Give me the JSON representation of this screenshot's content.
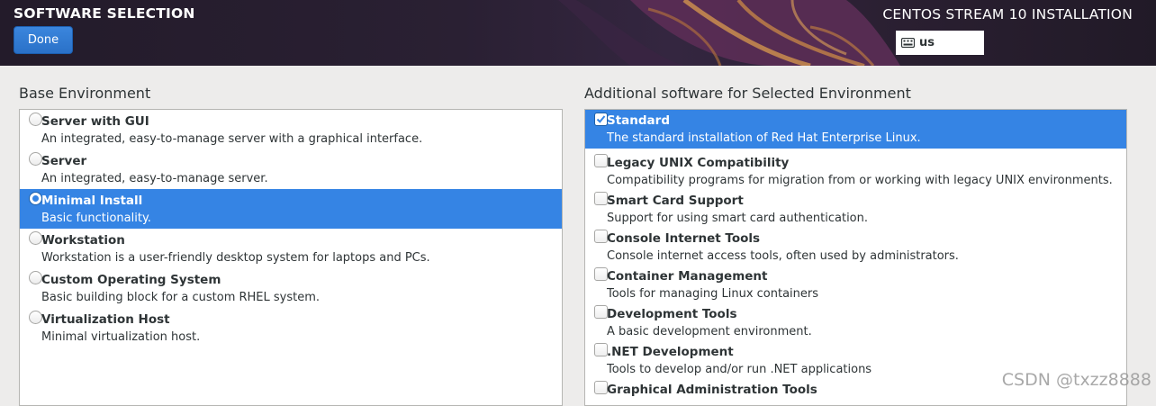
{
  "header": {
    "page_title": "SOFTWARE SELECTION",
    "done_label": "Done",
    "product_title": "CENTOS STREAM 10 INSTALLATION",
    "keyboard_layout": "us",
    "keyboard_icon": "keyboard-icon",
    "accent_color": "#3584e4"
  },
  "base_environment": {
    "title": "Base Environment",
    "selected_index": 2,
    "items": [
      {
        "name": "Server with GUI",
        "desc": "An integrated, easy-to-manage server with a graphical interface.",
        "selected": false
      },
      {
        "name": "Server",
        "desc": "An integrated, easy-to-manage server.",
        "selected": false
      },
      {
        "name": "Minimal Install",
        "desc": "Basic functionality.",
        "selected": true
      },
      {
        "name": "Workstation",
        "desc": "Workstation is a user-friendly desktop system for laptops and PCs.",
        "selected": false
      },
      {
        "name": "Custom Operating System",
        "desc": "Basic building block for a custom RHEL system.",
        "selected": false
      },
      {
        "name": "Virtualization Host",
        "desc": "Minimal virtualization host.",
        "selected": false
      }
    ]
  },
  "additional_software": {
    "title": "Additional software for Selected Environment",
    "items": [
      {
        "name": "Standard",
        "desc": "The standard installation of Red Hat Enterprise Linux.",
        "checked": true,
        "highlighted": true
      },
      {
        "name": "Legacy UNIX Compatibility",
        "desc": "Compatibility programs for migration from or working with legacy UNIX environments.",
        "checked": false,
        "highlighted": false
      },
      {
        "name": "Smart Card Support",
        "desc": "Support for using smart card authentication.",
        "checked": false,
        "highlighted": false
      },
      {
        "name": "Console Internet Tools",
        "desc": "Console internet access tools, often used by administrators.",
        "checked": false,
        "highlighted": false
      },
      {
        "name": "Container Management",
        "desc": "Tools for managing Linux containers",
        "checked": false,
        "highlighted": false
      },
      {
        "name": "Development Tools",
        "desc": "A basic development environment.",
        "checked": false,
        "highlighted": false
      },
      {
        "name": ".NET Development",
        "desc": "Tools to develop and/or run .NET applications",
        "checked": false,
        "highlighted": false
      },
      {
        "name": "Graphical Administration Tools",
        "desc": "",
        "checked": false,
        "highlighted": false
      }
    ]
  },
  "watermark": "CSDN @txzz8888"
}
